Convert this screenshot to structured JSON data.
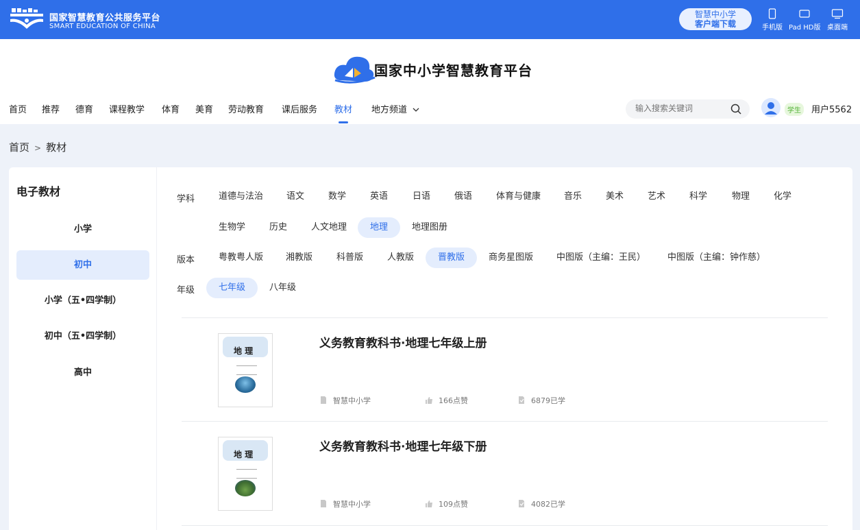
{
  "topbar": {
    "brand_cn": "国家智慧教育公共服务平台",
    "brand_en": "SMART EDUCATION OF CHINA",
    "download_line1": "智慧中小学",
    "download_line2": "客户端下载",
    "devices": [
      {
        "label": "手机版",
        "icon": "phone-icon"
      },
      {
        "label": "Pad HD版",
        "icon": "tablet-icon"
      },
      {
        "label": "桌面端",
        "icon": "desktop-icon"
      }
    ],
    "color": "#2f6fe9"
  },
  "header": {
    "site_title": "国家中小学智慧教育平台",
    "nav": [
      "首页",
      "推荐",
      "德育",
      "课程教学",
      "体育",
      "美育",
      "劳动教育",
      "课后服务",
      "教材",
      "地方频道"
    ],
    "active_nav": "教材",
    "search_placeholder": "输入搜索关键词",
    "role": "学生",
    "username": "用户5562"
  },
  "breadcrumb": [
    "首页",
    "教材"
  ],
  "sidebar": {
    "title": "电子教材",
    "items": [
      "小学",
      "初中",
      "小学（五•四学制）",
      "初中（五•四学制）",
      "高中"
    ],
    "active": "初中"
  },
  "filters": {
    "subject_label": "学科",
    "subjects_row1": [
      "道德与法治",
      "语文",
      "数学",
      "英语",
      "日语",
      "俄语",
      "体育与健康",
      "音乐",
      "美术",
      "艺术",
      "科学",
      "物理",
      "化学"
    ],
    "subjects_row2": [
      "生物学",
      "历史",
      "人文地理",
      "地理",
      "地理图册"
    ],
    "active_subject": "地理",
    "edition_label": "版本",
    "editions": [
      "粤教粤人版",
      "湘教版",
      "科普版",
      "人教版",
      "晋教版",
      "商务星图版",
      "中图版（主编：王民）",
      "中图版（主编：钟作慈）"
    ],
    "active_edition": "晋教版",
    "grade_label": "年级",
    "grades": [
      "七年级",
      "八年级"
    ],
    "active_grade": "七年级"
  },
  "books": [
    {
      "title": "义务教育教科书·地理七年级上册",
      "cover_text": "地 理",
      "source": "智慧中小学",
      "likes": "166点赞",
      "learners": "6879已学"
    },
    {
      "title": "义务教育教科书·地理七年级下册",
      "cover_text": "地 理",
      "source": "智慧中小学",
      "likes": "109点赞",
      "learners": "4082已学"
    }
  ]
}
